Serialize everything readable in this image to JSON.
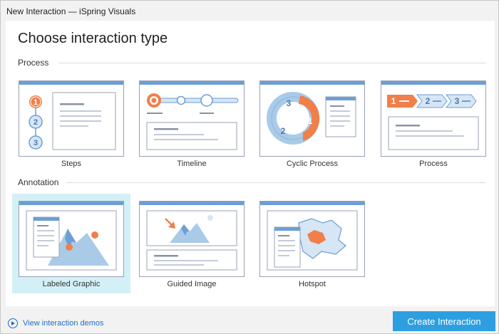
{
  "window": {
    "title": "New Interaction — iSpring Visuals"
  },
  "main": {
    "heading": "Choose interaction type",
    "sections": [
      {
        "label": "Process",
        "cards": [
          {
            "label": "Steps",
            "selected": false
          },
          {
            "label": "Timeline",
            "selected": false
          },
          {
            "label": "Cyclic Process",
            "selected": false
          },
          {
            "label": "Process",
            "selected": false
          }
        ]
      },
      {
        "label": "Annotation",
        "cards": [
          {
            "label": "Labeled Graphic",
            "selected": true
          },
          {
            "label": "Guided Image",
            "selected": false
          },
          {
            "label": "Hotspot",
            "selected": false
          }
        ]
      }
    ]
  },
  "thumb_text": {
    "steps": [
      "1",
      "2",
      "3"
    ],
    "cyclic": [
      "3",
      "1",
      "2"
    ],
    "process": [
      "1",
      "2",
      "3"
    ]
  },
  "footer": {
    "demo_link": "View interaction demos",
    "create_button": "Create Interaction"
  },
  "colors": {
    "accent_orange": "#f07f4a",
    "accent_blue": "#a9cbe8",
    "header_blue": "#6d9ed6",
    "primary_button": "#2d9fe0",
    "selected_card": "#d3f0f6",
    "link": "#1e6fc4"
  }
}
